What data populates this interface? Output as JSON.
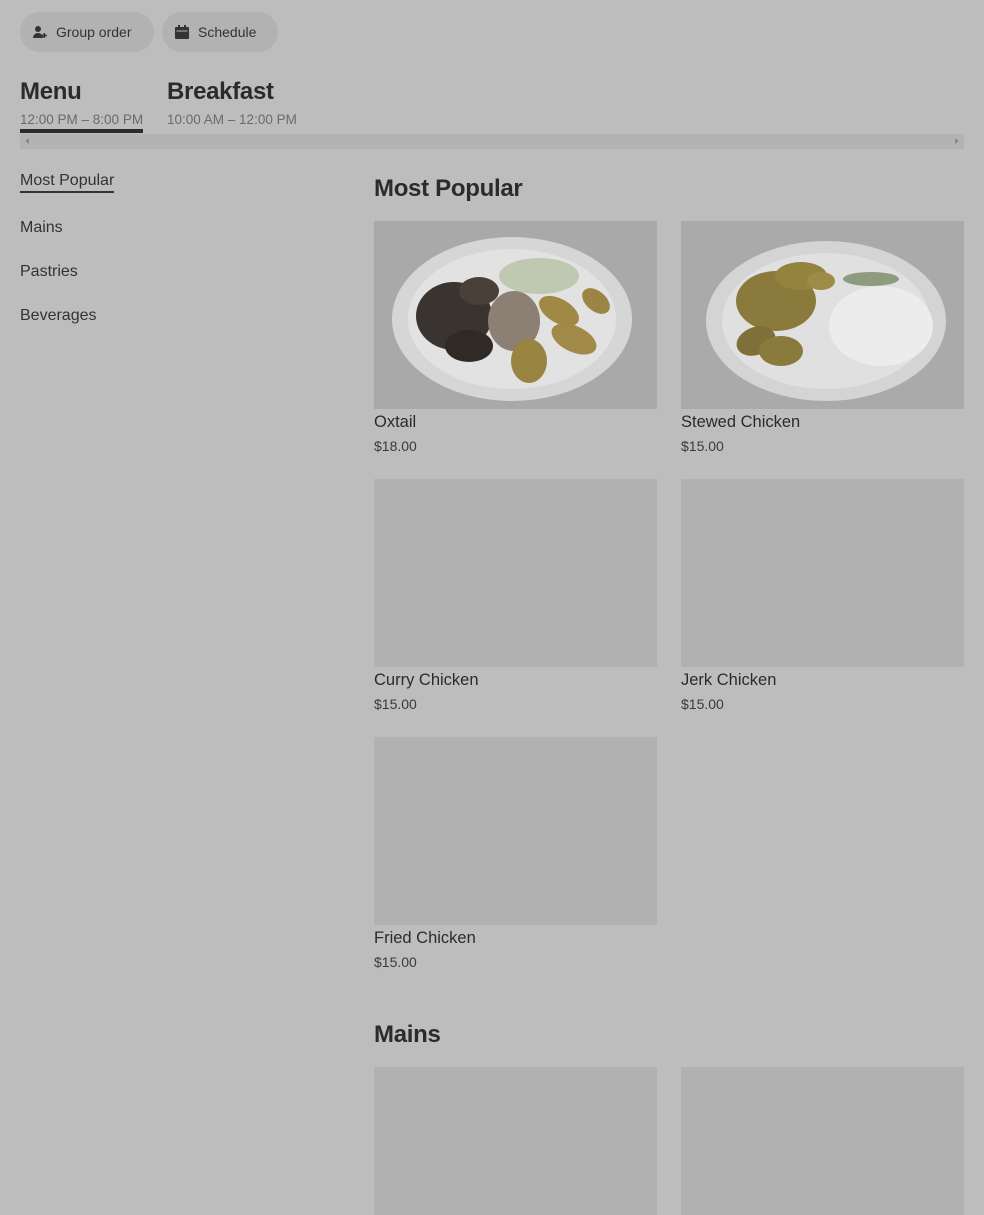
{
  "toolbar": {
    "group_order_label": "Group order",
    "schedule_label": "Schedule"
  },
  "menus": [
    {
      "name": "Menu",
      "hours": "12:00 PM – 8:00 PM",
      "active": true
    },
    {
      "name": "Breakfast",
      "hours": "10:00 AM – 12:00 PM",
      "active": false
    }
  ],
  "sidebar": {
    "items": [
      {
        "label": "Most Popular",
        "active": true
      },
      {
        "label": "Mains"
      },
      {
        "label": "Pastries"
      },
      {
        "label": "Beverages"
      }
    ]
  },
  "sections": {
    "most_popular": {
      "title": "Most Popular",
      "items": [
        {
          "name": "Oxtail",
          "price": "$18.00",
          "image": "oxtail-plate"
        },
        {
          "name": "Stewed Chicken",
          "price": "$15.00",
          "image": "stewed-chicken-plate"
        },
        {
          "name": "Curry Chicken",
          "price": "$15.00",
          "image": "placeholder"
        },
        {
          "name": "Jerk Chicken",
          "price": "$15.00",
          "image": "placeholder"
        },
        {
          "name": "Fried Chicken",
          "price": "$15.00",
          "image": "placeholder"
        }
      ]
    },
    "mains": {
      "title": "Mains"
    }
  },
  "colors": {
    "overlay_bg": "#bdbdbd",
    "pill_bg": "#b2b2b2",
    "placeholder": "#b1b1b1",
    "text": "#2b2b2b"
  }
}
